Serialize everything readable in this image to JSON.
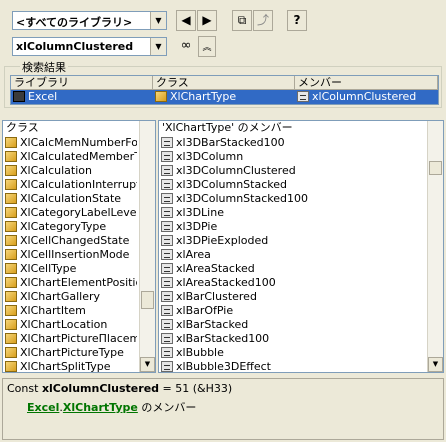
{
  "toolbar": {
    "library_value": "<すべてのライブラリ>",
    "search_value": "xlColumnClustered",
    "nav_back_icon": "arrow-left-icon",
    "nav_forward_icon": "arrow-right-icon",
    "copy_icon": "copy-icon",
    "view_definition_icon": "view-definition-icon",
    "help_label": "?",
    "search_icon": "binoculars-icon",
    "collapse_icon": "chevron-up-icon"
  },
  "search_results": {
    "group_label": "検索結果",
    "columns": [
      "ライブラリ",
      "クラス",
      "メンバー"
    ],
    "rows": [
      {
        "library": "Excel",
        "class": "XlChartType",
        "member": "xlColumnClustered"
      }
    ]
  },
  "classes_panel": {
    "header": "クラス",
    "items": [
      "XlCalcMemNumberFor",
      "XlCalculatedMemberT",
      "XlCalculation",
      "XlCalculationInterrupt",
      "XlCalculationState",
      "XlCategoryLabelLevel",
      "XlCategoryType",
      "XlCellChangedState",
      "XlCellInsertionMode",
      "XlCellType",
      "XlChartElementPositic",
      "XlChartGallery",
      "XlChartItem",
      "XlChartLocation",
      "XlChartPictureПlacem",
      "XlChartPictureType",
      "XlChartSplitType"
    ]
  },
  "members_panel": {
    "header": "'XlChartType' のメンバー",
    "items": [
      "xl3DBarStacked100",
      "xl3DColumn",
      "xl3DColumnClustered",
      "xl3DColumnStacked",
      "xl3DColumnStacked100",
      "xl3DLine",
      "xl3DPie",
      "xl3DPieExploded",
      "xlArea",
      "xlAreaStacked",
      "xlAreaStacked100",
      "xlBarClustered",
      "xlBarOfPie",
      "xlBarStacked",
      "xlBarStacked100",
      "xlBubble",
      "xlBubble3DEffect"
    ]
  },
  "details": {
    "const_prefix": "Const ",
    "const_name": "xlColumnClustered",
    "const_value": " = 51 (&H33)",
    "library_link": "Excel",
    "separator": ".",
    "class_link": "XlChartType",
    "member_suffix": " のメンバー"
  },
  "colors": {
    "selection": "#316ac5",
    "link": "#007500"
  }
}
